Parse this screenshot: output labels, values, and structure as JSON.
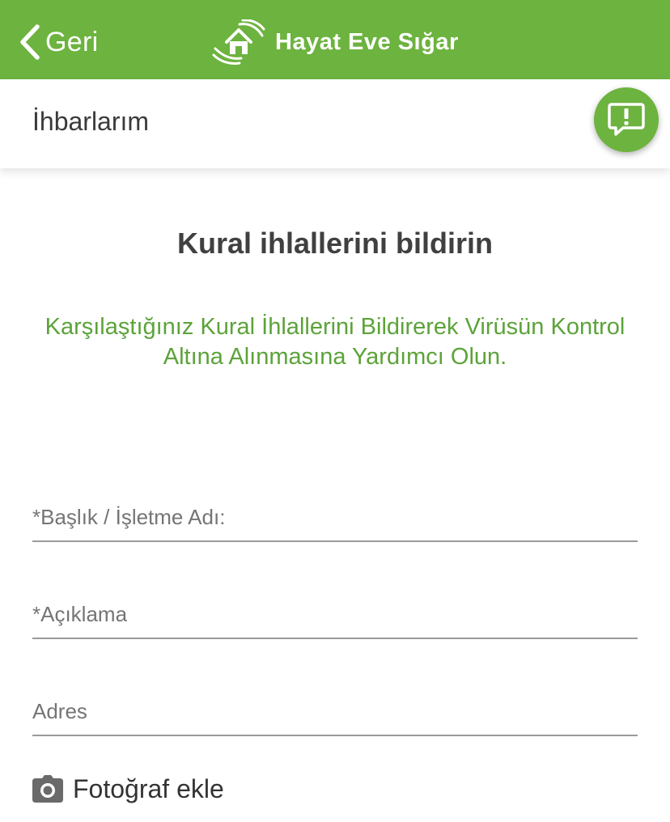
{
  "header": {
    "back_label": "Geri",
    "brand_name": "Hayat Eve Sığar",
    "logo_icon": "house-hands-icon",
    "background_color": "#6db33f"
  },
  "subheader": {
    "title": "İhbarlarım",
    "action_icon": "report-bubble-icon"
  },
  "main": {
    "heading": "Kural ihlallerini bildirin",
    "description": "Karşılaştığınız Kural İhlallerini Bildirerek Virüsün Kontrol Altına Alınmasına Yardımcı Olun.",
    "accent_color": "#5ca33a"
  },
  "form": {
    "title_placeholder": "*Başlık / İşletme Adı:",
    "title_value": "",
    "description_placeholder": "*Açıklama",
    "description_value": "",
    "address_placeholder": "Adres",
    "address_value": "",
    "photo_label": "Fotoğraf ekle",
    "photo_icon": "camera-icon"
  }
}
